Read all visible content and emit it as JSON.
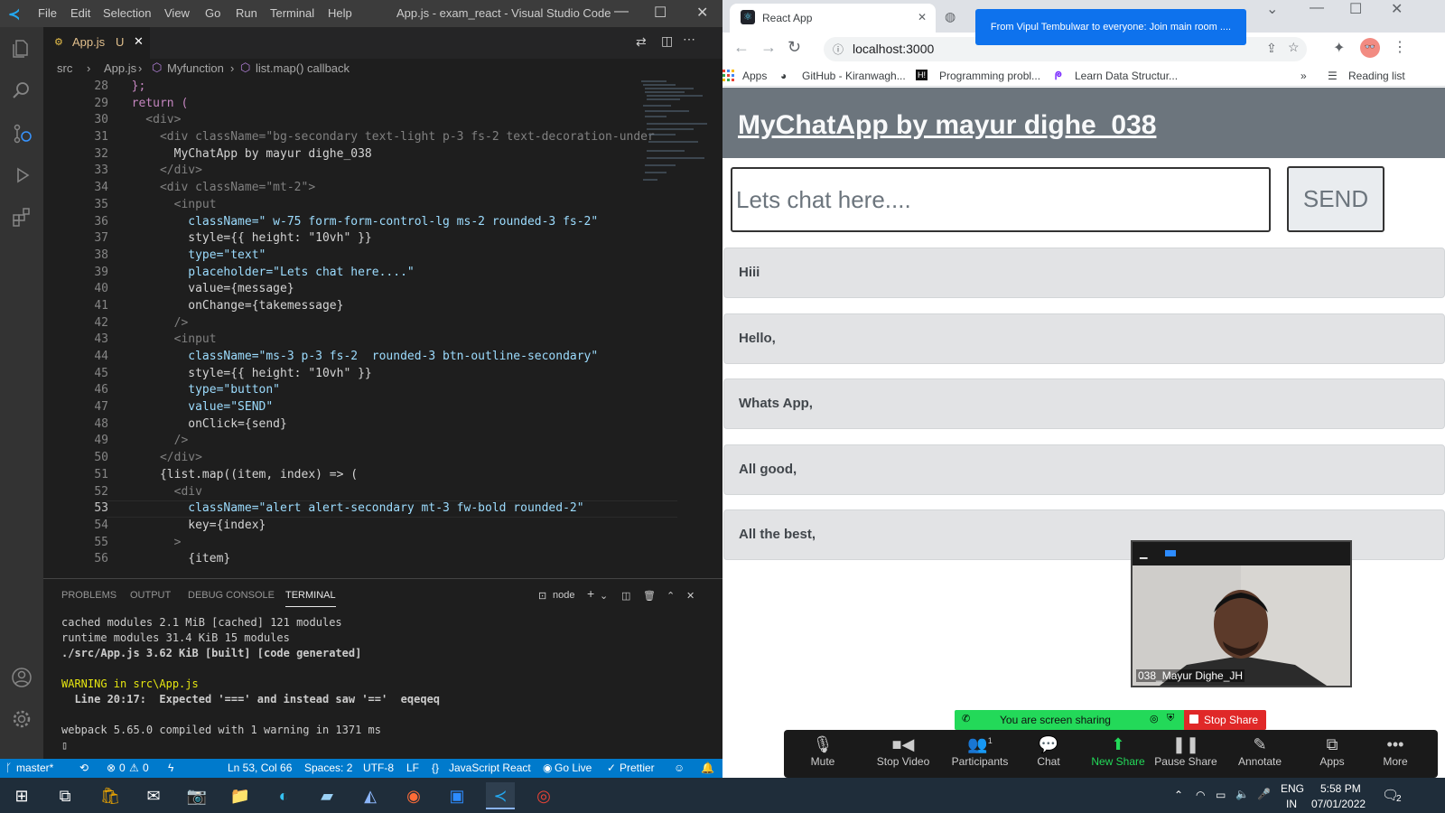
{
  "vscode": {
    "title": "App.js - exam_react - Visual Studio Code",
    "menu": [
      "File",
      "Edit",
      "Selection",
      "View",
      "Go",
      "Run",
      "Terminal",
      "Help"
    ],
    "tab": {
      "name": "App.js",
      "status": "U"
    },
    "breadcrumb": [
      "src",
      "App.js",
      "Myfunction",
      "list.map() callback"
    ],
    "line_numbers": [
      "28",
      "29",
      "30",
      "31",
      "32",
      "33",
      "34",
      "35",
      "36",
      "37",
      "38",
      "39",
      "40",
      "41",
      "42",
      "43",
      "44",
      "45",
      "46",
      "47",
      "48",
      "49",
      "50",
      "51",
      "52",
      "53",
      "54",
      "55",
      "56"
    ],
    "code_lines": [
      "  };",
      "  return (",
      "    <div>",
      "      <div className=\"bg-secondary text-light p-3 fs-2 text-decoration-under",
      "        MyChatApp by mayur dighe_038",
      "      </div>",
      "      <div className=\"mt-2\">",
      "        <input",
      "          className=\" w-75 form-form-control-lg ms-2 rounded-3 fs-2\"",
      "          style={{ height: \"10vh\" }}",
      "          type=\"text\"",
      "          placeholder=\"Lets chat here....\"",
      "          value={message}",
      "          onChange={takemessage}",
      "        />",
      "        <input",
      "          className=\"ms-3 p-3 fs-2  rounded-3 btn-outline-secondary\"",
      "          style={{ height: \"10vh\" }}",
      "          type=\"button\"",
      "          value=\"SEND\"",
      "          onClick={send}",
      "        />",
      "      </div>",
      "      {list.map((item, index) => (",
      "        <div",
      "          className=\"alert alert-secondary mt-3 fw-bold rounded-2\"",
      "          key={index}",
      "        >",
      "          {item}"
    ],
    "panel_tabs": [
      "PROBLEMS",
      "OUTPUT",
      "DEBUG CONSOLE",
      "TERMINAL"
    ],
    "terminal_shell": "node",
    "terminal_lines": [
      "cached modules 2.1 MiB [cached] 121 modules",
      "runtime modules 31.4 KiB 15 modules",
      "./src/App.js 3.62 KiB [built] [code generated]",
      "",
      "WARNING in src\\App.js",
      "  Line 20:17:  Expected '===' and instead saw '=='  eqeqeq",
      "",
      "webpack 5.65.0 compiled with 1 warning in 1371 ms",
      "▯"
    ],
    "status": {
      "branch": "master*",
      "errors": "0",
      "warnings": "0",
      "position": "Ln 53, Col 66",
      "spaces": "Spaces: 2",
      "encoding": "UTF-8",
      "eol": "LF",
      "language": "JavaScript React",
      "golive": "Go Live",
      "prettier": "Prettier"
    }
  },
  "chrome": {
    "tab_title": "React App",
    "url": "localhost:3000",
    "bookmarks": [
      "Apps",
      "GitHub - Kiranwagh...",
      "Programming probl...",
      "Learn Data Structur..."
    ],
    "reading_list": "Reading list"
  },
  "app": {
    "title": "MyChatApp by mayur dighe_038",
    "placeholder": "Lets chat here....",
    "send_label": "SEND",
    "messages": [
      "Hiii",
      "Hello,",
      "Whats App,",
      "All good,",
      "All the best,"
    ]
  },
  "zoom": {
    "notification": "From Vipul Tembulwar to everyone: Join main room ....",
    "video_name": "038_Mayur Dighe_JH",
    "sharing_text": "You are screen sharing",
    "stop_share": "Stop Share",
    "participants_count": "1",
    "buttons": [
      "Mute",
      "Stop Video",
      "Participants",
      "Chat",
      "New Share",
      "Pause Share",
      "Annotate",
      "Apps",
      "More"
    ]
  },
  "taskbar": {
    "lang": "ENG",
    "region": "IN",
    "time": "5:58 PM",
    "date": "07/01/2022",
    "notifications": "2"
  }
}
